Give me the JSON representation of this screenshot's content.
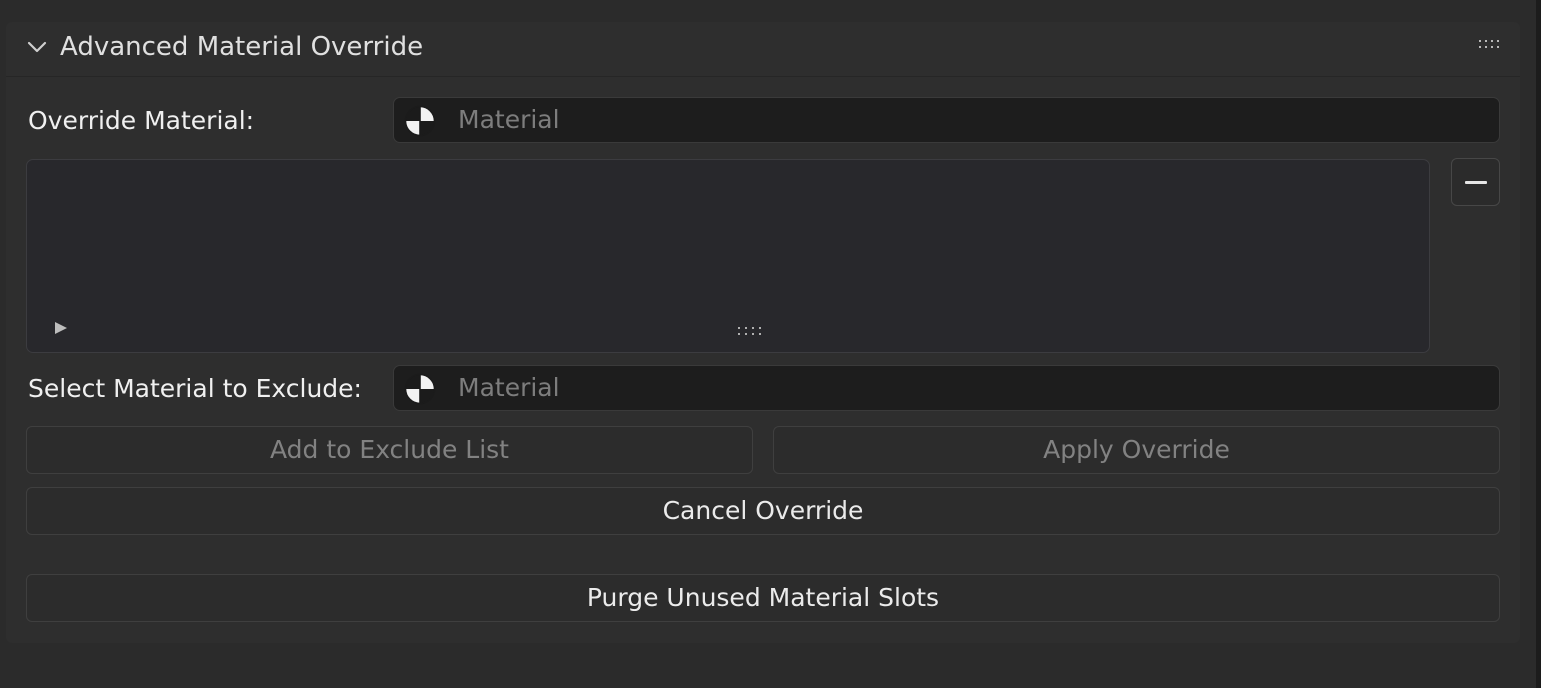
{
  "panel": {
    "title": "Advanced Material Override",
    "expanded": true
  },
  "override_row": {
    "label": "Override Material:",
    "placeholder": "Material"
  },
  "exclude_row": {
    "label": "Select Material to Exclude:",
    "placeholder": "Material"
  },
  "buttons": {
    "add_exclude": "Add to Exclude List",
    "apply_override": "Apply Override",
    "cancel_override": "Cancel Override",
    "purge_slots": "Purge Unused Material Slots"
  },
  "icons": {
    "collapse": "chevron-down-icon",
    "panel_grip": "drag-grip-icon",
    "material": "material-sphere-icon",
    "remove": "minus-icon",
    "list_expand": "triangle-right-icon",
    "list_resize": "resize-grip-icon"
  },
  "colors": {
    "background": "#2b2b2b",
    "panel": "#2e2e2e",
    "field": "#1d1d1d",
    "list": "#28282c",
    "text": "#e6e6e6",
    "placeholder": "#7d7d7d"
  }
}
